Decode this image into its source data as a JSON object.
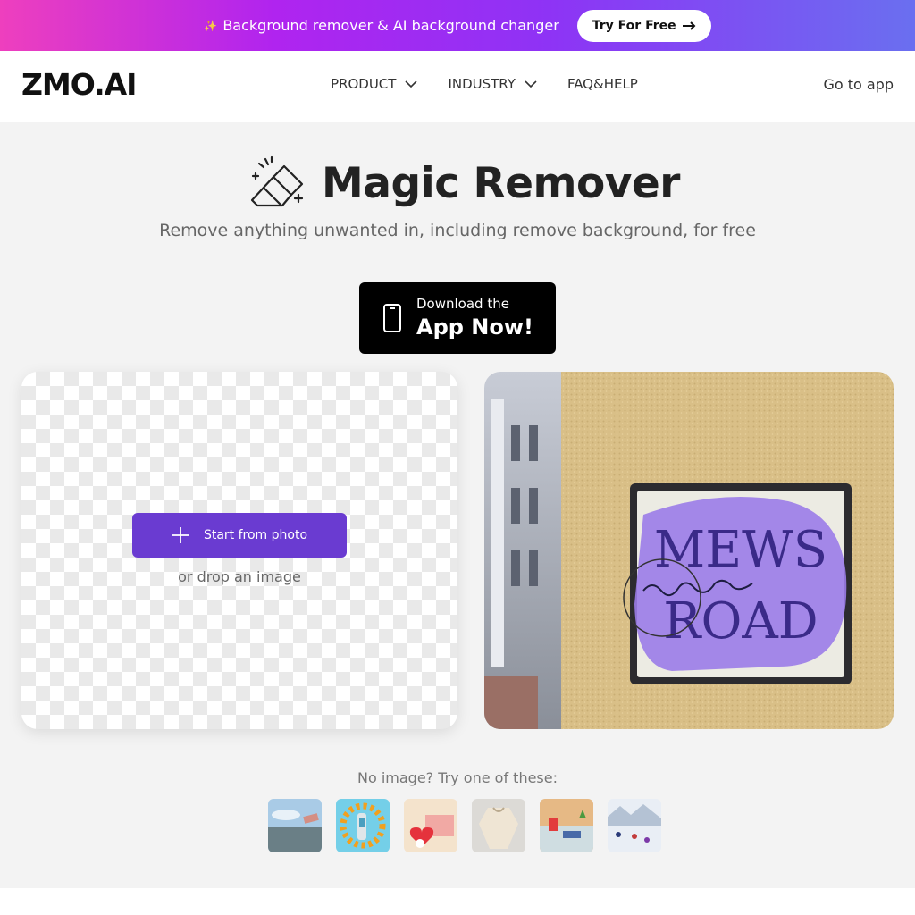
{
  "promo": {
    "text": "Background remover & AI background changer",
    "button_label": "Try For Free"
  },
  "nav": {
    "logo": "ZMO.AI",
    "items": [
      {
        "label": "PRODUCT"
      },
      {
        "label": "INDUSTRY"
      },
      {
        "label": "FAQ&HELP"
      }
    ],
    "go_app": "Go to app"
  },
  "hero": {
    "title": "Magic Remover",
    "subtitle": "Remove anything unwanted in, including remove background, for free"
  },
  "app_download": {
    "line1": "Download the",
    "line2": "App Now!"
  },
  "upload": {
    "button_label": "Start from photo",
    "drop_text": "or drop an image"
  },
  "preview": {
    "sign_line1": "MEWS",
    "sign_line2": "ROAD",
    "highlight_color": "#9b7ce8"
  },
  "samples": {
    "label": "No image? Try one of these:",
    "thumbnails": [
      "building-sky",
      "pills-clock",
      "heart-box",
      "knit-sweater",
      "desk-items",
      "ski-slope"
    ]
  },
  "colors": {
    "accent": "#6a3bd1",
    "promo_gradient_start": "#ee3fbe",
    "promo_gradient_end": "#6a6ff0"
  }
}
